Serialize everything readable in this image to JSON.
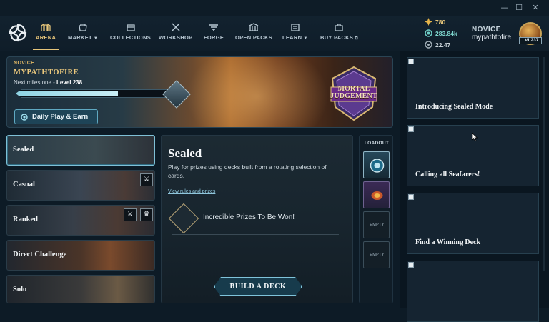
{
  "window": {
    "minimize": "—",
    "maximize": "☐",
    "close": "✕"
  },
  "nav": {
    "items": [
      {
        "label": "ARENA",
        "icon": "arena-icon",
        "active": true,
        "dropdown": false
      },
      {
        "label": "MARKET",
        "icon": "market-icon",
        "active": false,
        "dropdown": true
      },
      {
        "label": "COLLECTIONS",
        "icon": "collections-icon",
        "active": false,
        "dropdown": false
      },
      {
        "label": "WORKSHOP",
        "icon": "workshop-icon",
        "active": false,
        "dropdown": false
      },
      {
        "label": "FORGE",
        "icon": "forge-icon",
        "active": false,
        "dropdown": false
      },
      {
        "label": "OPEN PACKS",
        "icon": "open-packs-icon",
        "active": false,
        "dropdown": false
      },
      {
        "label": "LEARN",
        "icon": "learn-icon",
        "active": false,
        "dropdown": true
      },
      {
        "label": "BUY PACKS",
        "icon": "buy-packs-icon",
        "active": false,
        "dropdown": false,
        "external": true
      }
    ],
    "currencies": [
      {
        "value": "780",
        "icon": "star-currency-icon",
        "color": "#e6b54a"
      },
      {
        "value": "283.84k",
        "icon": "gem-currency-icon",
        "color": "#6fd0c8"
      },
      {
        "value": "22.47",
        "icon": "coin-currency-icon",
        "color": "#a7b4bc"
      }
    ],
    "rank": "NOVICE",
    "username": "mypathtofire",
    "level": "LVL237"
  },
  "hero": {
    "rank": "NOVICE",
    "name": "MYPATHTOFIRE",
    "milestone_prefix": "Next milestone - ",
    "milestone_level": "Level 238",
    "progress": 0.65,
    "daily_button": "Daily Play & Earn",
    "crest_line1": "MORTAL",
    "crest_line2": "JUDGEMENT"
  },
  "modes": [
    {
      "label": "Sealed",
      "selected": true,
      "tags": []
    },
    {
      "label": "Casual",
      "selected": false,
      "tags": [
        "crossed-swords-icon"
      ]
    },
    {
      "label": "Ranked",
      "selected": false,
      "tags": [
        "crossed-swords-icon",
        "crown-icon"
      ]
    },
    {
      "label": "Direct Challenge",
      "selected": false,
      "tags": []
    },
    {
      "label": "Solo",
      "selected": false,
      "tags": []
    }
  ],
  "details": {
    "title": "Sealed",
    "description": "Play for prizes using decks built from a rotating selection of cards.",
    "link": "View rules and prizes",
    "prize_text": "Incredible Prizes To Be Won!",
    "build_button": "BUILD A DECK"
  },
  "loadout": {
    "title": "LOADOUT",
    "empty_label": "EMPTY"
  },
  "news": [
    {
      "title": "Introducing Sealed Mode"
    },
    {
      "title": "Calling all Seafarers!"
    },
    {
      "title": "Find a Winning Deck"
    },
    {
      "title": ""
    }
  ]
}
